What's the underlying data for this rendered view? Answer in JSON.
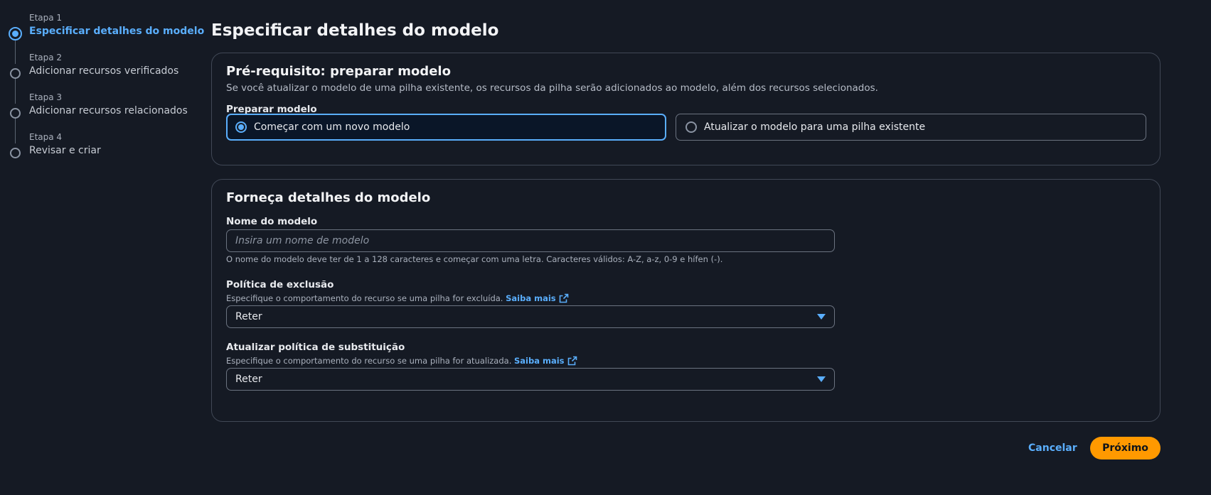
{
  "steps": [
    {
      "number": "Etapa 1",
      "title": "Especificar detalhes do modelo",
      "active": true
    },
    {
      "number": "Etapa 2",
      "title": "Adicionar recursos verificados",
      "active": false
    },
    {
      "number": "Etapa 3",
      "title": "Adicionar recursos relacionados",
      "active": false
    },
    {
      "number": "Etapa 4",
      "title": "Revisar e criar",
      "active": false
    }
  ],
  "page": {
    "title": "Especificar detalhes do modelo"
  },
  "prerequisite": {
    "heading": "Pré-requisito: preparar modelo",
    "description": "Se você atualizar o modelo de uma pilha existente, os recursos da pilha serão adicionados ao modelo, além dos recursos selecionados.",
    "field_label": "Preparar modelo",
    "options": [
      {
        "label": "Começar com um novo modelo",
        "selected": true
      },
      {
        "label": "Atualizar o modelo para uma pilha existente",
        "selected": false
      }
    ]
  },
  "details": {
    "heading": "Forneça detalhes do modelo",
    "name_label": "Nome do modelo",
    "name_placeholder": "Insira um nome de modelo",
    "name_value": "",
    "name_hint": "O nome do modelo deve ter de 1 a 128 caracteres e começar com uma letra. Caracteres válidos: A-Z, a-z, 0-9 e hífen (-).",
    "deletion_label": "Política de exclusão",
    "deletion_desc": "Especifique o comportamento do recurso se uma pilha for excluída.",
    "deletion_link": "Saiba mais",
    "deletion_value": "Reter",
    "replace_label": "Atualizar política de substituição",
    "replace_desc": "Especifique o comportamento do recurso se uma pilha for atualizada.",
    "replace_link": "Saiba mais",
    "replace_value": "Reter"
  },
  "footer": {
    "cancel_label": "Cancelar",
    "next_label": "Próximo"
  },
  "colors": {
    "accent": "#5aaefc",
    "primary_button": "#ff9900",
    "background": "#151a24"
  },
  "icons": {
    "external_link": "external-link-icon",
    "dropdown": "caret-down-icon"
  }
}
